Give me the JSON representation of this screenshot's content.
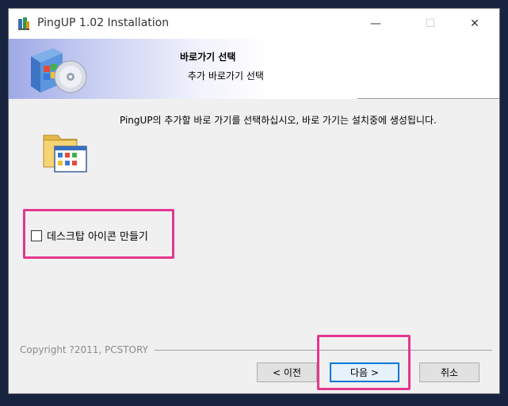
{
  "window": {
    "title": "PingUP 1.02 Installation",
    "minimize_glyph": "—",
    "maximize_glyph": "☐",
    "close_glyph": "✕"
  },
  "banner": {
    "title": "바로가기 선택",
    "subtitle": "추가 바로가기 선택"
  },
  "content": {
    "description": "PingUP의 추가할 바로 가기를 선택하십시오, 바로 가기는 설치중에 생성됩니다.",
    "desktop_icon_checkbox": {
      "label": "데스크탑 아이콘 만들기",
      "checked": false
    }
  },
  "footer": {
    "copyright": "Copyright ?2011, PCSTORY",
    "back_label": "< 이전",
    "next_label": "다음 >",
    "cancel_label": "취소"
  },
  "colors": {
    "highlight": "#e4378f",
    "focus": "#0078d7",
    "background": "#17233f"
  }
}
